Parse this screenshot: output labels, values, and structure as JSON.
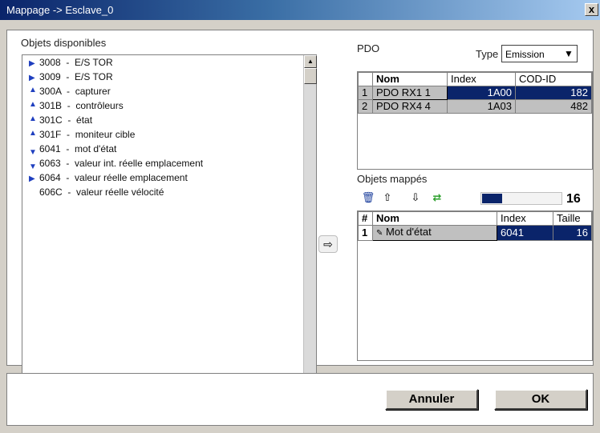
{
  "window": {
    "title": "Mappage  ->  Esclave_0",
    "close_label": "x"
  },
  "objects": {
    "label": "Objets disponibles",
    "items": [
      {
        "code": "3008",
        "desc": "-  E/S TOR",
        "marker": "right"
      },
      {
        "code": "3009",
        "desc": "-  E/S TOR",
        "marker": "right"
      },
      {
        "code": "300A",
        "desc": "-  capturer",
        "marker": "up"
      },
      {
        "code": "301B",
        "desc": "-  contrôleurs",
        "marker": "up"
      },
      {
        "code": "301C",
        "desc": "-  état",
        "marker": "up"
      },
      {
        "code": "301F",
        "desc": "-  moniteur cible",
        "marker": "up"
      },
      {
        "code": "6041",
        "desc": "-  mot d'état",
        "marker": "down"
      },
      {
        "code": "6063",
        "desc": "-  valeur int. réelle emplacement",
        "marker": "down"
      },
      {
        "code": "6064",
        "desc": "-  valeur réelle emplacement",
        "marker": "right"
      },
      {
        "code": "606C",
        "desc": "-  valeur réelle vélocité",
        "marker": "none"
      }
    ]
  },
  "pdo": {
    "label": "PDO",
    "type_label": "Type",
    "type_value": "Emission",
    "columns": [
      "",
      "Nom",
      "Index",
      "COD-ID"
    ],
    "rows": [
      {
        "num": "1",
        "nom": "PDO RX1 1",
        "index": "1A00",
        "codid": "182",
        "selected": true
      },
      {
        "num": "2",
        "nom": "PDO RX4 4",
        "index": "1A03",
        "codid": "482",
        "selected": false
      }
    ]
  },
  "mapped": {
    "label": "Objets mappés",
    "fill_fraction": 0.25,
    "size_value": "16",
    "columns": [
      "#",
      "Nom",
      "Index",
      "Taille"
    ],
    "rows": [
      {
        "num": "1",
        "nom": "Mot d'état",
        "index": "6041",
        "taille": "16"
      }
    ]
  },
  "buttons": {
    "cancel": "Annuler",
    "ok": "OK"
  },
  "icons": {
    "transfer": "right-arrow-icon",
    "delete": "trash-icon",
    "up": "arrow-up-icon",
    "down": "arrow-down-icon",
    "refresh": "refresh-icon"
  },
  "colors": {
    "selection": "#0a246a",
    "tab_gray": "#c0c0c0"
  }
}
